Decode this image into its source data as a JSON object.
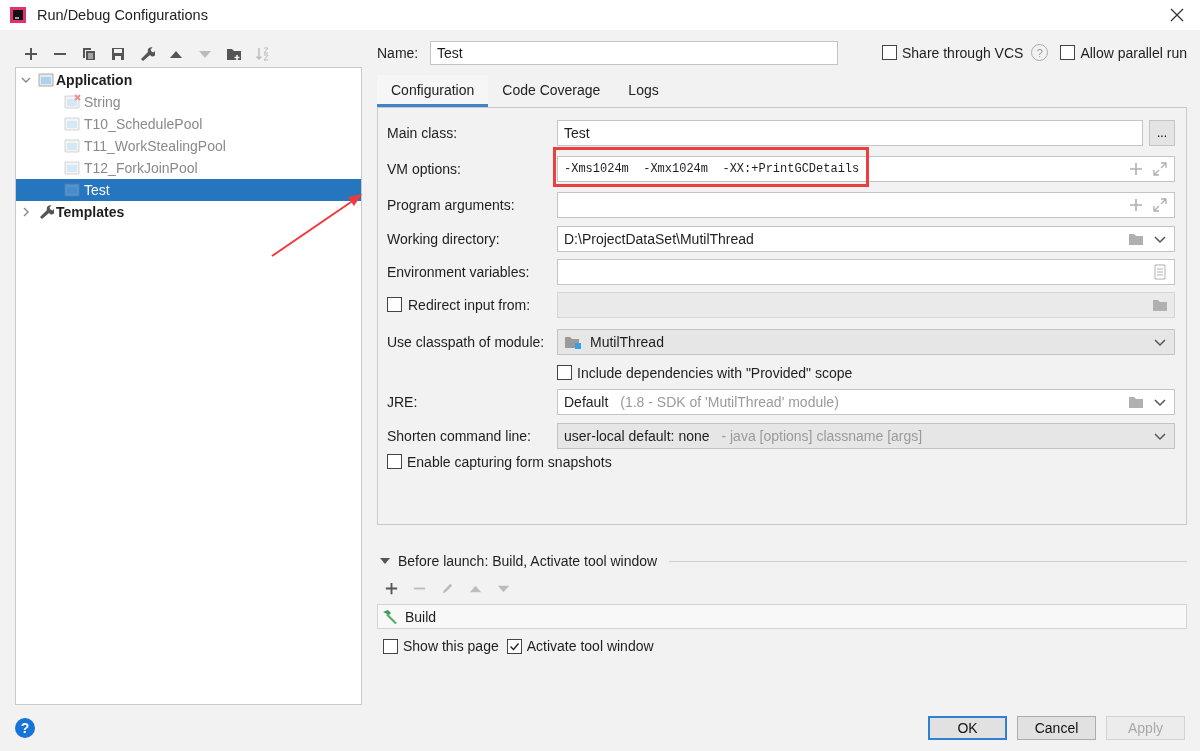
{
  "window": {
    "title": "Run/Debug Configurations"
  },
  "toolbar": [
    {
      "kind": "add",
      "disabled": false
    },
    {
      "kind": "remove",
      "disabled": false
    },
    {
      "kind": "copy",
      "disabled": false
    },
    {
      "kind": "save",
      "disabled": false
    },
    {
      "kind": "wrench",
      "disabled": false
    },
    {
      "kind": "up",
      "disabled": false
    },
    {
      "kind": "down",
      "disabled": true
    },
    {
      "kind": "folder",
      "disabled": false
    },
    {
      "kind": "sort",
      "disabled": true
    }
  ],
  "tree": [
    {
      "label": "Application",
      "kind": "application",
      "expanded": true,
      "children": [
        {
          "label": "String",
          "error": true,
          "selected": false
        },
        {
          "label": "T10_SchedulePool",
          "error": false,
          "selected": false
        },
        {
          "label": "T11_WorkStealingPool",
          "error": false,
          "selected": false
        },
        {
          "label": "T12_ForkJoinPool",
          "error": false,
          "selected": false
        },
        {
          "label": "Test",
          "error": false,
          "selected": true
        }
      ]
    },
    {
      "label": "Templates",
      "kind": "templates",
      "expanded": false
    }
  ],
  "name": {
    "label": "Name:",
    "value": "Test"
  },
  "share_vcs": {
    "label": "Share through VCS",
    "checked": false,
    "help": "?"
  },
  "allow_parallel": {
    "label": "Allow parallel run",
    "checked": false
  },
  "tabs": [
    {
      "label": "Configuration",
      "selected": true
    },
    {
      "label": "Code Coverage",
      "selected": false
    },
    {
      "label": "Logs",
      "selected": false
    }
  ],
  "form": [
    {
      "kind": "field",
      "label": "Main class:",
      "value": "Test",
      "button": "..."
    },
    {
      "kind": "expand_field",
      "label": "VM options:",
      "value": "-Xms1024m  -Xmx1024m  -XX:+PrintGCDetails",
      "highlighted": true
    },
    {
      "kind": "expand_field",
      "label": "Program arguments:"
    },
    {
      "kind": "path_field",
      "label": "Working directory:",
      "value": "D:\\ProjectDataSet\\MutilThread"
    },
    {
      "kind": "env_field",
      "label": "Environment variables:"
    },
    {
      "kind": "check_field",
      "label": "Redirect input from:",
      "checked": false
    },
    {
      "kind": "module_dropdown",
      "label": "Use classpath of module:",
      "value": "MutilThread"
    },
    {
      "kind": "check",
      "label": "Include dependencies with \"Provided\" scope",
      "checked": false,
      "indented": true
    },
    {
      "kind": "jre",
      "label": "JRE:",
      "value": "Default",
      "hint": "(1.8 - SDK of 'MutilThread' module)"
    },
    {
      "kind": "dropdown",
      "label": "Shorten command line:",
      "value": "user-local default: none",
      "hint": "- java [options] classname [args]"
    },
    {
      "kind": "check",
      "label": "Enable capturing form snapshots",
      "checked": false,
      "indented": false
    }
  ],
  "before_launch": {
    "title": "Before launch: Build, Activate tool window",
    "expanded": true,
    "toolbar": [
      {
        "kind": "add",
        "disabled": false
      },
      {
        "kind": "remove",
        "disabled": true
      },
      {
        "kind": "edit",
        "disabled": true
      },
      {
        "kind": "up",
        "disabled": true
      },
      {
        "kind": "down",
        "disabled": true
      }
    ],
    "tasks": [
      {
        "label": "Build"
      }
    ],
    "options": [
      {
        "label": "Show this page",
        "checked": false
      },
      {
        "label": "Activate tool window",
        "checked": true
      }
    ]
  },
  "help": "?",
  "buttons": [
    {
      "label": "OK",
      "kind": "default",
      "disabled": false
    },
    {
      "label": "Cancel",
      "kind": "normal",
      "disabled": false
    },
    {
      "label": "Apply",
      "kind": "normal",
      "disabled": true
    }
  ]
}
